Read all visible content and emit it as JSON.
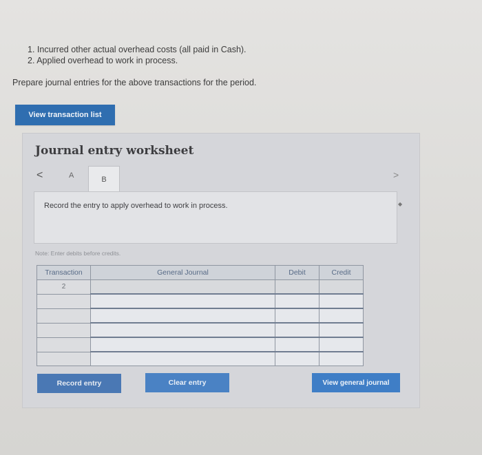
{
  "questions": {
    "line1": "1. Incurred other actual overhead costs (all paid in Cash).",
    "line2": "2. Applied overhead to work in process."
  },
  "prompt": "Prepare journal entries for the above transactions for the period.",
  "view_transaction_list": "View transaction list",
  "worksheet": {
    "title": "Journal entry worksheet",
    "nav_left": "<",
    "nav_right": ">",
    "tabs": [
      "A",
      "B"
    ],
    "active_tab": "B",
    "instruction": "Record the entry to apply overhead to work in process.",
    "note": "Note: Enter debits before credits.",
    "table": {
      "headers": [
        "Transaction",
        "General Journal",
        "Debit",
        "Credit"
      ],
      "rows": [
        {
          "transaction": "2"
        },
        {
          "transaction": ""
        },
        {
          "transaction": ""
        },
        {
          "transaction": ""
        },
        {
          "transaction": ""
        },
        {
          "transaction": ""
        }
      ]
    },
    "buttons": {
      "record": "Record entry",
      "clear": "Clear entry",
      "view_journal": "View general journal"
    }
  },
  "colors": {
    "primary_button": "#2f6eb0",
    "panel_bg": "#d5d6da",
    "table_header_text": "#576a86"
  }
}
